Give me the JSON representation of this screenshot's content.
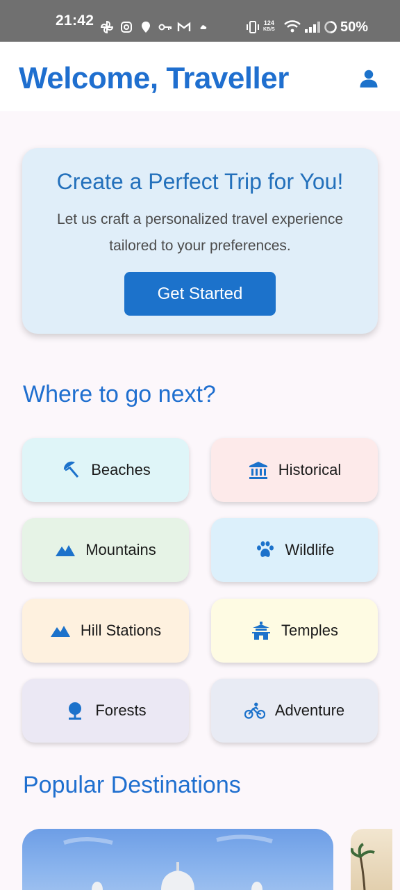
{
  "status_bar": {
    "time": "21:42",
    "network_speed_value": "124",
    "network_speed_unit": "KB/S",
    "battery": "50%"
  },
  "header": {
    "title": "Welcome, Traveller",
    "profile_icon": "person-icon"
  },
  "hero": {
    "title": "Create a Perfect Trip for You!",
    "description": "Let us craft a personalized travel experience tailored to your preferences.",
    "button_label": "Get Started"
  },
  "categories_section": {
    "title": "Where to go next?",
    "items": [
      {
        "label": "Beaches",
        "icon": "beach-umbrella-icon",
        "color": "#dff5f8"
      },
      {
        "label": "Historical",
        "icon": "museum-icon",
        "color": "#fdeaea"
      },
      {
        "label": "Mountains",
        "icon": "mountain-icon",
        "color": "#e6f3e6"
      },
      {
        "label": "Wildlife",
        "icon": "paw-icon",
        "color": "#dcf0fb"
      },
      {
        "label": "Hill Stations",
        "icon": "mountain-icon",
        "color": "#fef1df"
      },
      {
        "label": "Temples",
        "icon": "temple-icon",
        "color": "#fefbe3"
      },
      {
        "label": "Forests",
        "icon": "tree-icon",
        "color": "#ebe8f4"
      },
      {
        "label": "Adventure",
        "icon": "bike-icon",
        "color": "#e8ebf4"
      }
    ]
  },
  "destinations_section": {
    "title": "Popular Destinations"
  },
  "colors": {
    "accent": "#1f6fcf",
    "button": "#1c72cb",
    "hero_bg": "#e0eef9",
    "page_bg": "#fcf7fb"
  }
}
